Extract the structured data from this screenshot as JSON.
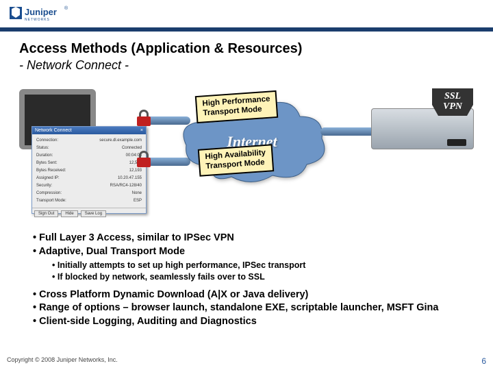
{
  "header": {
    "brand": "Juniper",
    "brand_sub": "NETWORKS"
  },
  "title": "Access Methods (Application & Resources)",
  "subtitle": "- Network Connect -",
  "diagram": {
    "dialog": {
      "title": "Network Connect",
      "rows": [
        {
          "k": "Connection:",
          "v": "secure.dl.example.com"
        },
        {
          "k": "Status:",
          "v": "Connected"
        },
        {
          "k": "Duration:",
          "v": "00:04:06"
        },
        {
          "k": "Bytes Sent:",
          "v": "12,591"
        },
        {
          "k": "Bytes Received:",
          "v": "12,193"
        },
        {
          "k": "Assigned IP:",
          "v": "10.20.47.155"
        },
        {
          "k": "Security:",
          "v": "RSA/RC4-128/40"
        },
        {
          "k": "Compression:",
          "v": "None"
        },
        {
          "k": "Transport Mode:",
          "v": "ESP"
        }
      ],
      "buttons": [
        "Sign Out",
        "Hide",
        "Save Log"
      ]
    },
    "cloud_label": "Internet",
    "callout1": {
      "l1": "High Performance",
      "l2": "Transport Mode"
    },
    "callout2": {
      "l1": "High Availability",
      "l2": "Transport Mode"
    },
    "appliance_badge": {
      "l1": "SSL",
      "l2": "VPN"
    }
  },
  "bullets": {
    "group1": [
      "Full Layer 3 Access, similar to IPSec VPN",
      "Adaptive, Dual Transport Mode"
    ],
    "group1_sub": [
      "Initially attempts to set up high performance, IPSec transport",
      "If blocked by network, seamlessly fails over to SSL"
    ],
    "group2": [
      "Cross Platform Dynamic Download (A|X or Java delivery)",
      "Range of options – browser launch, standalone EXE, scriptable launcher, MSFT Gina",
      "Client-side Logging, Auditing and Diagnostics"
    ]
  },
  "footer": {
    "copyright": "Copyright © 2008 Juniper Networks, Inc.",
    "page": "6"
  }
}
